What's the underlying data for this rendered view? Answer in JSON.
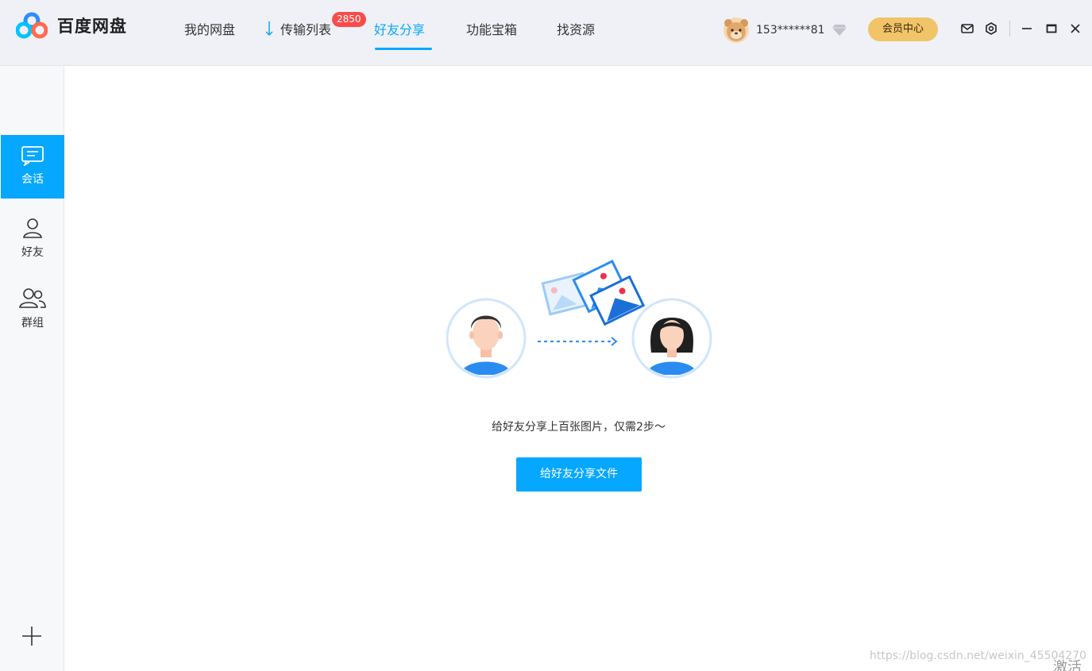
{
  "app": {
    "name": "百度网盘"
  },
  "nav": {
    "items": [
      {
        "label": "我的网盘"
      },
      {
        "label": "传输列表"
      },
      {
        "label": "好友分享"
      },
      {
        "label": "功能宝箱"
      },
      {
        "label": "找资源"
      }
    ],
    "active_index": 2,
    "transfer_badge": "2850"
  },
  "user": {
    "name": "153******81",
    "vip_label": "会员中心"
  },
  "sidebar": {
    "items": [
      {
        "label": "会话",
        "icon": "chat-icon"
      },
      {
        "label": "好友",
        "icon": "person-icon"
      },
      {
        "label": "群组",
        "icon": "group-icon"
      }
    ],
    "active_index": 0,
    "add_icon": "plus-icon"
  },
  "main": {
    "tip": "给好友分享上百张图片，仅需2步～",
    "share_button": "给好友分享文件"
  },
  "watermark": "https://blog.csdn.net/weixin_45504270",
  "corner_text": "激活",
  "colors": {
    "accent": "#06a7ff",
    "badge": "#fa4b4b",
    "vip": "#f1c468",
    "sidebar_bg": "#f7f8fa",
    "titlebar_bg": "#eff1f6"
  }
}
